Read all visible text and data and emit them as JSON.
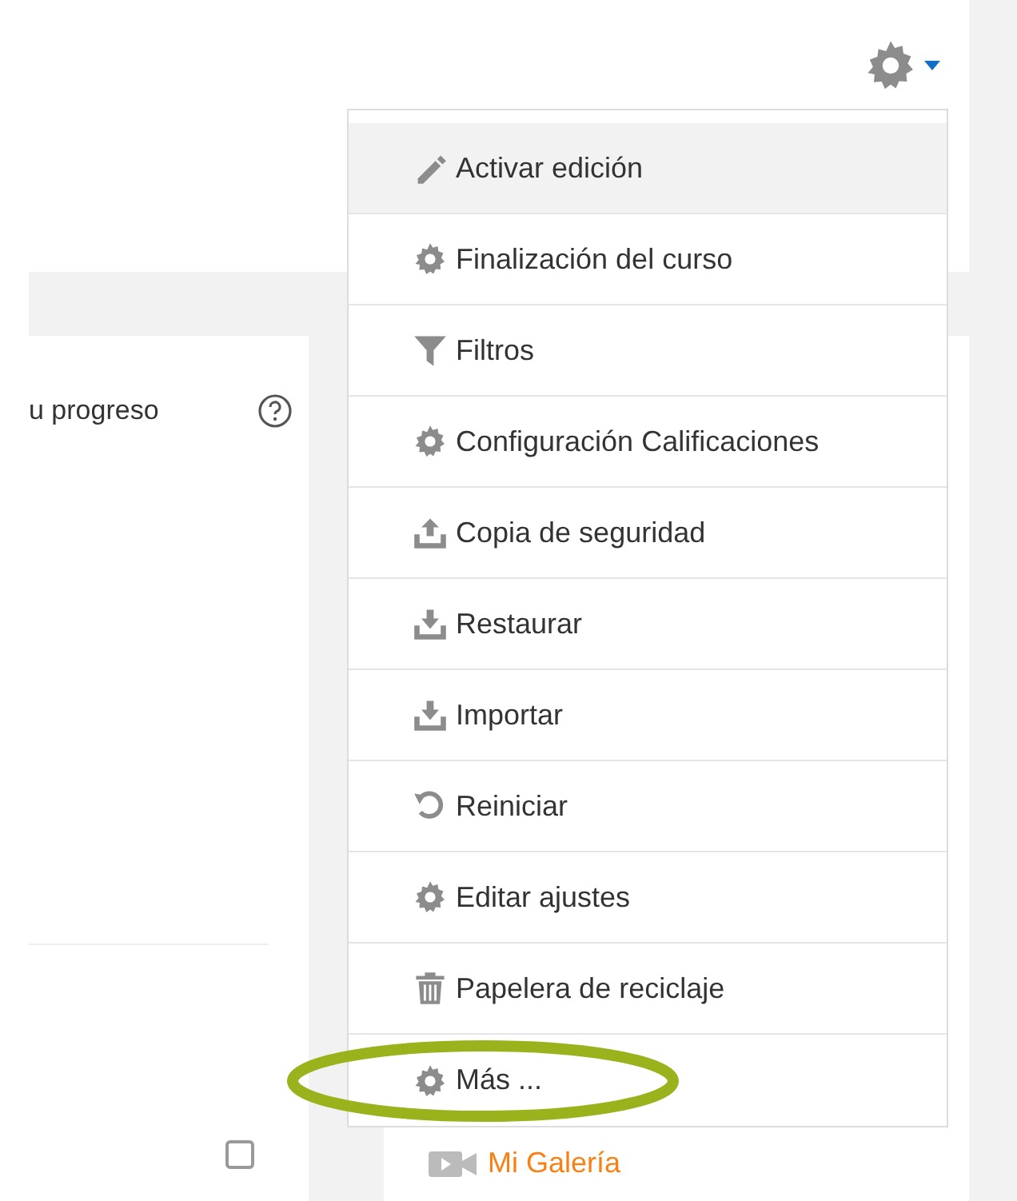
{
  "settings_menu": {
    "expanded": true,
    "items": [
      {
        "kind": "pencil",
        "label": "Activar edición",
        "highlighted": true,
        "circled": false
      },
      {
        "kind": "gear",
        "label": "Finalización del curso",
        "highlighted": false,
        "circled": false
      },
      {
        "kind": "filter",
        "label": "Filtros",
        "highlighted": false,
        "circled": false
      },
      {
        "kind": "gear",
        "label": "Configuración Calificaciones",
        "highlighted": false,
        "circled": false
      },
      {
        "kind": "upload",
        "label": "Copia de seguridad",
        "highlighted": false,
        "circled": false
      },
      {
        "kind": "download",
        "label": "Restaurar",
        "highlighted": false,
        "circled": false
      },
      {
        "kind": "download",
        "label": "Importar",
        "highlighted": false,
        "circled": false
      },
      {
        "kind": "reset",
        "label": "Reiniciar",
        "highlighted": false,
        "circled": false
      },
      {
        "kind": "gear",
        "label": "Editar ajustes",
        "highlighted": false,
        "circled": false
      },
      {
        "kind": "trash",
        "label": "Papelera de reciclaje",
        "highlighted": false,
        "circled": false
      },
      {
        "kind": "gear",
        "label": "Más ...",
        "highlighted": false,
        "circled": true
      }
    ]
  },
  "left_panel": {
    "text": "u progreso",
    "checkbox": {
      "checked": false
    }
  },
  "right_panel": {
    "link": "Mi Galería"
  }
}
